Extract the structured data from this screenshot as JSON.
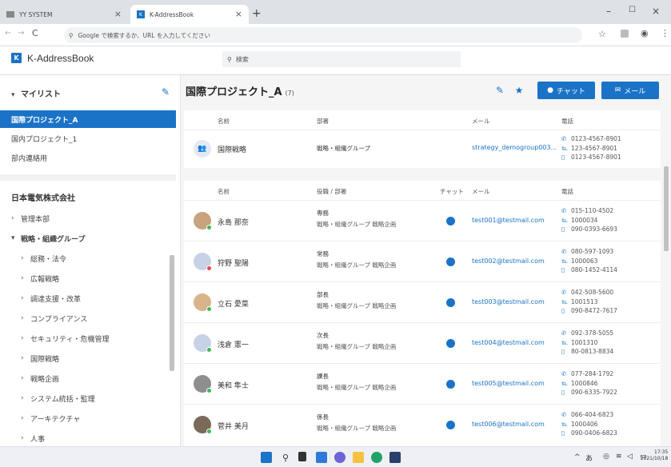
{
  "browser": {
    "tabs": [
      {
        "label": "YY SYSTEM"
      },
      {
        "label": "K-AddressBook"
      }
    ],
    "omnibox_placeholder": "Google で検索するか、URL を入力してください"
  },
  "app": {
    "name": "K-AddressBook",
    "search_placeholder": "検索"
  },
  "sidebar": {
    "mylist_title": "マイリスト",
    "mylist_items": [
      {
        "label": "国際プロジェクト_A",
        "selected": true
      },
      {
        "label": "国内プロジェクト_1"
      },
      {
        "label": "部内連絡用"
      }
    ],
    "company_title": "日本電気株式会社",
    "org_items": [
      {
        "label": "管理本部",
        "level": 0,
        "expanded": false
      },
      {
        "label": "戦略・組織グループ",
        "level": 0,
        "expanded": true
      },
      {
        "label": "総務・法令",
        "level": 1
      },
      {
        "label": "広報戦略",
        "level": 1
      },
      {
        "label": "調達支援・改革",
        "level": 1
      },
      {
        "label": "コンプライアンス",
        "level": 1
      },
      {
        "label": "セキュリティ・危機管理",
        "level": 1
      },
      {
        "label": "国際戦略",
        "level": 1
      },
      {
        "label": "戦略企画",
        "level": 1
      },
      {
        "label": "システム統括・監理",
        "level": 1
      },
      {
        "label": "アーキテクチャ",
        "level": 1
      },
      {
        "label": "人事",
        "level": 1
      }
    ]
  },
  "main": {
    "group_title": "国際プロジェクト_A",
    "group_count": "(7)",
    "chat_button": "チャット",
    "mail_button": "メール",
    "group_table": {
      "headers": {
        "name": "名前",
        "dept": "部署",
        "mail": "メール",
        "phone": "電話"
      },
      "row": {
        "name": "国際戦略",
        "dept": "戦略・組織グループ",
        "mail": "strategy_demogroup003...",
        "phone": "0123-4567-8901",
        "fax": "123-4567-8901",
        "mobile": "0123-4567-8901"
      }
    },
    "member_table": {
      "headers": {
        "name": "名前",
        "title": "役職 / 部署",
        "chat": "チャット",
        "mail": "メール",
        "phone": "電話"
      },
      "rows": [
        {
          "name": "永島 那奈",
          "title": "専務",
          "dept": "戦略・組織グループ 戦略企画",
          "mail": "test001@testmail.com",
          "phone": "015-110-4502",
          "ext": "1000034",
          "mobile": "090-0393-6693",
          "status": "#3fb950",
          "avatar": "#c9a27e"
        },
        {
          "name": "狩野 聖陽",
          "title": "常務",
          "dept": "戦略・組織グループ 戦略企画",
          "mail": "test002@testmail.com",
          "phone": "080-597-1093",
          "ext": "1000063",
          "mobile": "080-1452-4114",
          "status": "#e5484d",
          "avatar": "#c8d2e6"
        },
        {
          "name": "立石 愛菜",
          "title": "部長",
          "dept": "戦略・組織グループ 戦略企画",
          "mail": "test003@testmail.com",
          "phone": "042-508-5600",
          "ext": "1001513",
          "mobile": "090-8472-7617",
          "status": "#3fb950",
          "avatar": "#d9b48a"
        },
        {
          "name": "浅倉 憲一",
          "title": "次長",
          "dept": "戦略・組織グループ 戦略企画",
          "mail": "test004@testmail.com",
          "phone": "092-378-5055",
          "ext": "1001310",
          "mobile": "80-0813-8834",
          "status": "#3fb950",
          "avatar": "#c8d2e6"
        },
        {
          "name": "美和 隼士",
          "title": "課長",
          "dept": "戦略・組織グループ 戦略企画",
          "mail": "test005@testmail.com",
          "phone": "077-284-1792",
          "ext": "1000846",
          "mobile": "090-6335-7922",
          "status": "#3fb950",
          "avatar": "#8e8e8e"
        },
        {
          "name": "菅井 美月",
          "title": "係長",
          "dept": "戦略・組織グループ 戦略企画",
          "mail": "test006@testmail.com",
          "phone": "066-404-6823",
          "ext": "1000406",
          "mobile": "090-0406-6823",
          "status": "#3fb950",
          "avatar": "#7a6a5a"
        }
      ]
    }
  },
  "taskbar": {
    "ime": "あ",
    "time": "17:35",
    "date": "2021/10/18"
  },
  "colors": {
    "accent": "#1b73c7"
  }
}
